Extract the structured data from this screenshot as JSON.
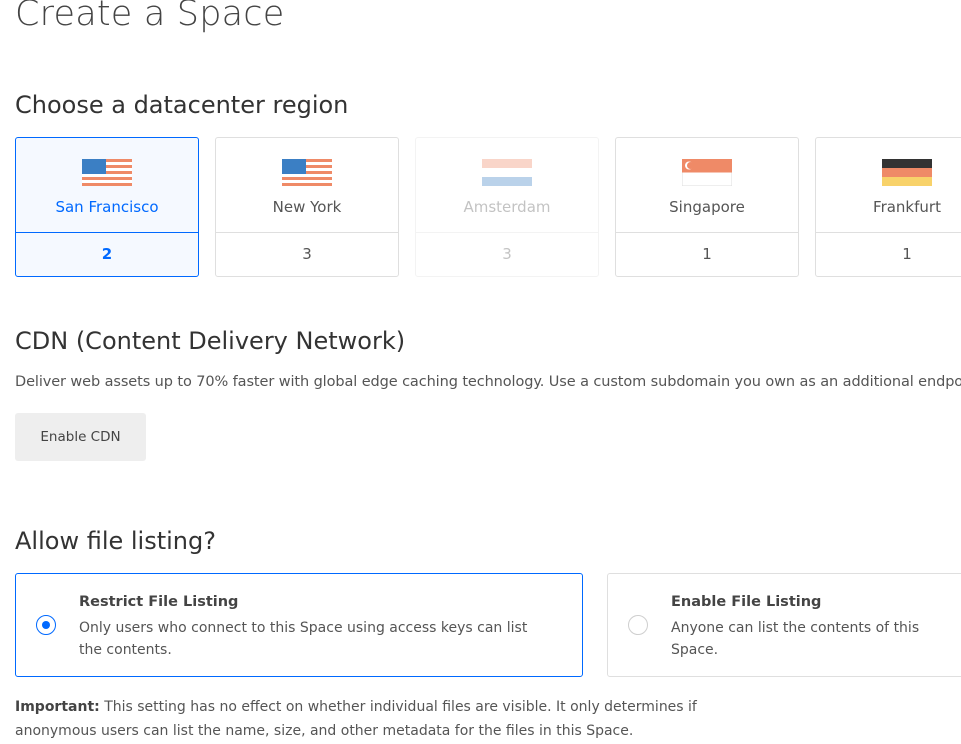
{
  "page": {
    "title": "Create a Space"
  },
  "datacenter": {
    "heading": "Choose a datacenter region",
    "regions": [
      {
        "name": "San Francisco",
        "count": "2",
        "flag": "us-flag-icon",
        "selected": true,
        "disabled": false
      },
      {
        "name": "New York",
        "count": "3",
        "flag": "us-flag-icon",
        "selected": false,
        "disabled": false
      },
      {
        "name": "Amsterdam",
        "count": "3",
        "flag": "nl-flag-icon",
        "selected": false,
        "disabled": true
      },
      {
        "name": "Singapore",
        "count": "1",
        "flag": "sg-flag-icon",
        "selected": false,
        "disabled": false
      },
      {
        "name": "Frankfurt",
        "count": "1",
        "flag": "de-flag-icon",
        "selected": false,
        "disabled": false
      }
    ]
  },
  "cdn": {
    "heading": "CDN (Content Delivery Network)",
    "description": "Deliver web assets up to 70% faster with global edge caching technology. Use a custom subdomain you own as an additional endpoint.",
    "button_label": "Enable CDN"
  },
  "file_listing": {
    "heading": "Allow file listing?",
    "options": [
      {
        "title": "Restrict File Listing",
        "description": "Only users who connect to this Space using access keys can list the contents.",
        "selected": true
      },
      {
        "title": "Enable File Listing",
        "description": "Anyone can list the contents of this Space.",
        "selected": false
      }
    ],
    "important_label": "Important:",
    "important_text": " This setting has no effect on whether individual files are visible. It only determines if anonymous users can list the name, size, and other metadata for the files in this Space."
  },
  "colors": {
    "accent": "#0069ff",
    "selected_bg": "#f5f9ff",
    "border": "#dfdfdf",
    "button_bg": "#eeeeee"
  }
}
